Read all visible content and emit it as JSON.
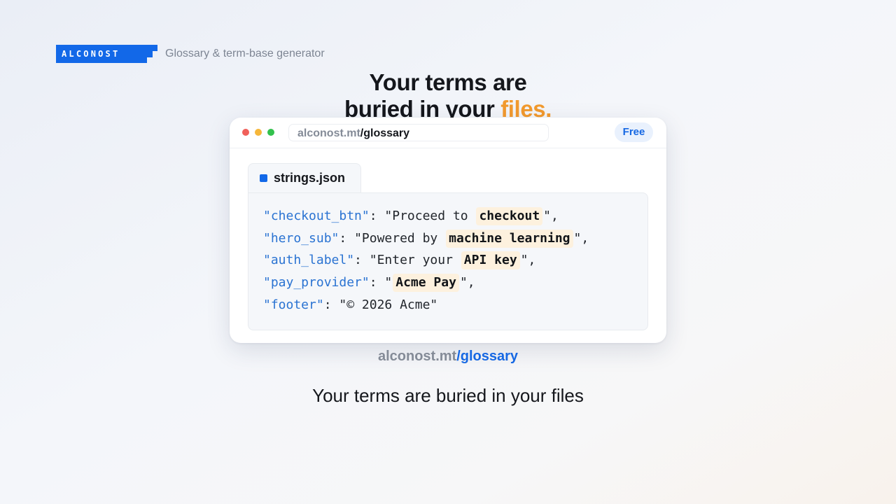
{
  "brand": {
    "logo_text": "ALCONOST",
    "tagline": "Glossary & term-base generator",
    "color": "#1268e8"
  },
  "headline": {
    "line1": "Your terms are",
    "line2_pre": "buried in your",
    "line2_accent": "files.",
    "accent_color": "#f29a2e"
  },
  "window": {
    "url_host": "alconost.mt",
    "url_path": "/glossary",
    "badge": "Free",
    "file_tab": {
      "name": "strings.json",
      "icon": "file-square-icon"
    },
    "code_lines": [
      {
        "key": "\"checkout_btn\"",
        "sep": ": ",
        "pre": "\"Proceed to",
        "term": "checkout",
        "post": "\","
      },
      {
        "key": "\"hero_sub\"",
        "sep": ": ",
        "pre": "\"Powered by",
        "term": "machine learning",
        "post": "\","
      },
      {
        "key": "\"auth_label\"",
        "sep": ": ",
        "pre": "\"Enter your",
        "term": "API key",
        "post": "\","
      },
      {
        "key": "\"pay_provider\"",
        "sep": ": ",
        "pre": "\"",
        "term": "Acme Pay",
        "post": "\","
      },
      {
        "key": "\"footer\"",
        "sep": ": ",
        "pre": "\"© 2026 Acme\"",
        "term": "",
        "post": ""
      }
    ]
  },
  "caption": {
    "url_host": "alconost.mt",
    "url_path": "/glossary"
  },
  "subtitle": "Your terms are buried in your files",
  "colors": {
    "key": "#2a73d2",
    "term_highlight": "#fdf1de",
    "link": "#1668e3"
  }
}
